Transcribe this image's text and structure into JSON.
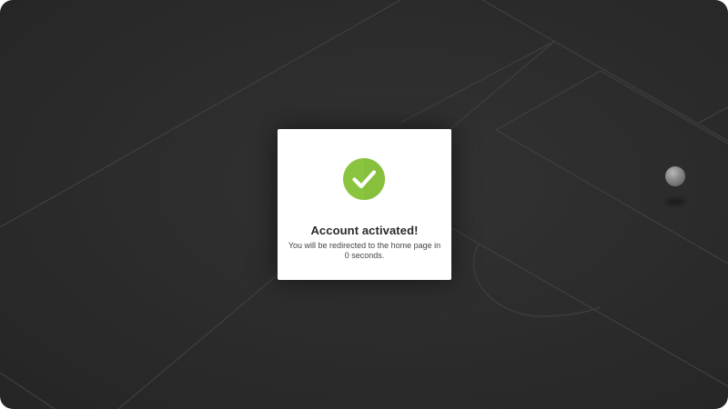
{
  "background": {
    "description_icon": "soccer-field-lines"
  },
  "modal": {
    "icon": "checkmark-circle-icon",
    "icon_color": "#8bc540",
    "title": "Account activated!",
    "message": "You will be redirected to the home page in 0 seconds."
  }
}
